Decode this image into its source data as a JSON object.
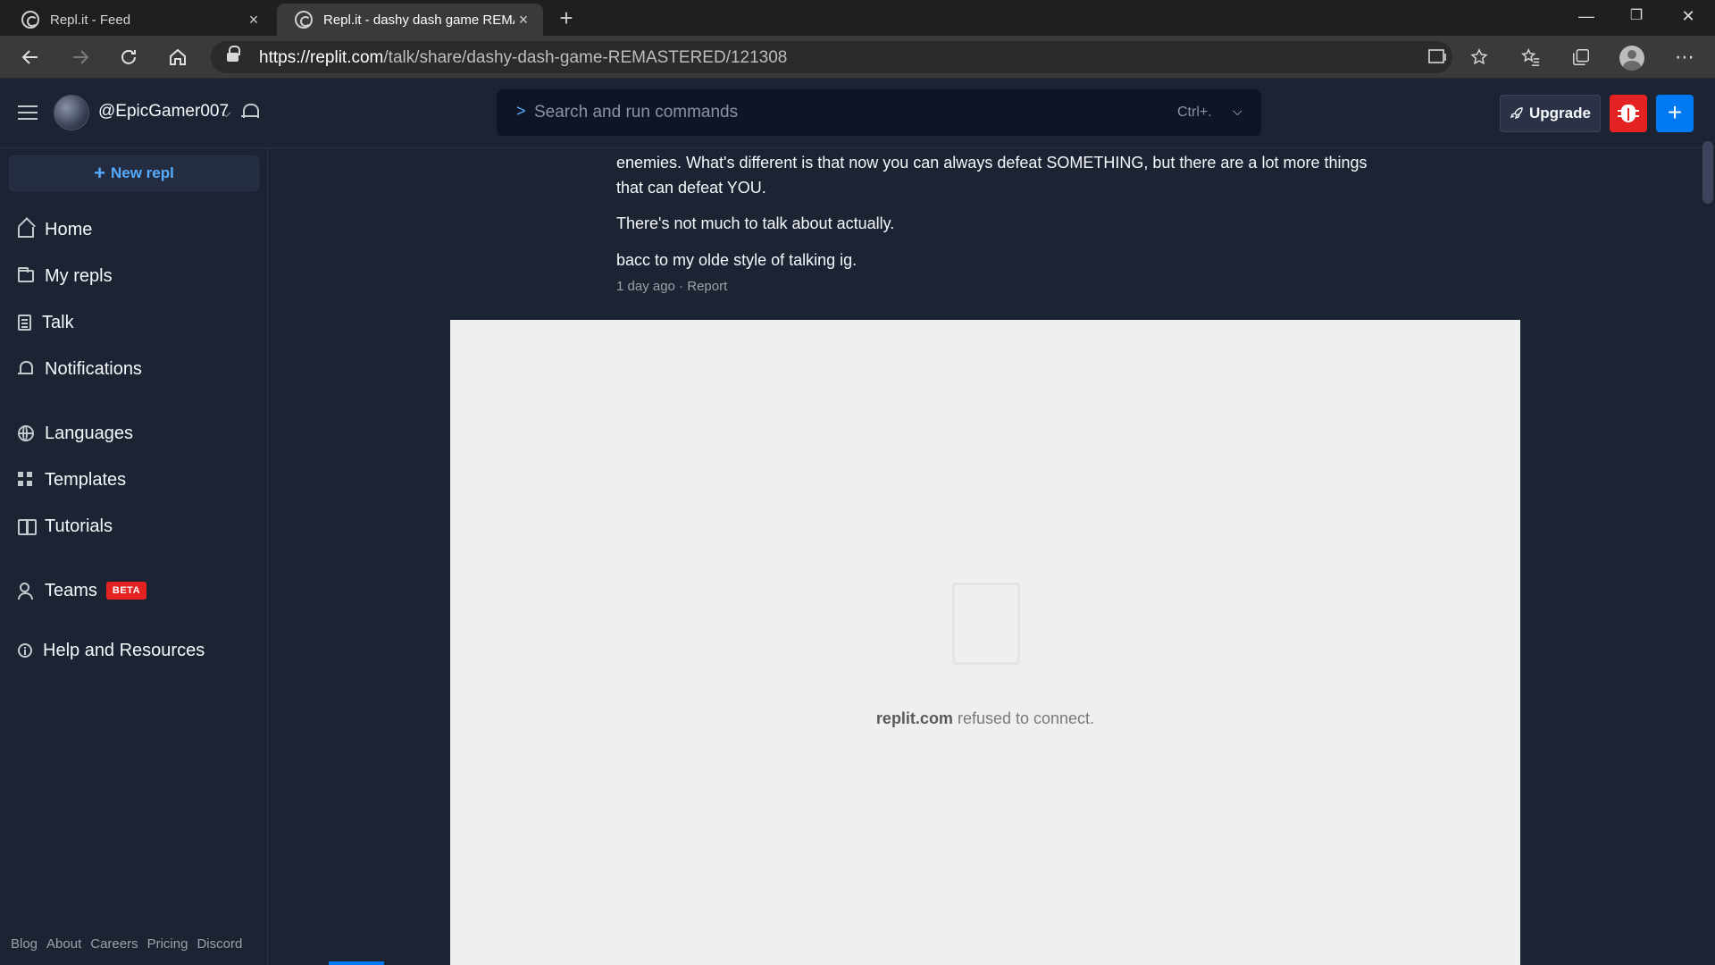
{
  "browser": {
    "tabs": [
      {
        "title": "Repl.it - Feed"
      },
      {
        "title": "Repl.it - dashy dash game REMA"
      }
    ],
    "close_glyph": "×",
    "new_tab_glyph": "+",
    "url_host": "https://replit.com",
    "url_path": "/talk/share/dashy-dash-game-REMASTERED/121308",
    "window_controls": {
      "minimize": "—",
      "maximize": "❐",
      "close": "✕"
    },
    "icons": [
      "back-arrow-icon",
      "forward-arrow-icon",
      "refresh-icon",
      "home-icon",
      "lock-icon",
      "read-aloud-icon",
      "add-favorite-icon",
      "favorites-icon",
      "collections-icon",
      "profile-icon",
      "more-icon"
    ]
  },
  "header": {
    "username": "@EpicGamer007",
    "search_placeholder": "Search and run commands",
    "shortcut": "Ctrl+.",
    "upgrade_label": "Upgrade"
  },
  "sidebar": {
    "new_repl_label": "New repl",
    "items": [
      {
        "label": "Home",
        "icon": "home-icon"
      },
      {
        "label": "My repls",
        "icon": "folder-icon"
      },
      {
        "label": "Talk",
        "icon": "talk-icon"
      },
      {
        "label": "Notifications",
        "icon": "bell-icon"
      },
      {
        "label": "Languages",
        "icon": "globe-icon"
      },
      {
        "label": "Templates",
        "icon": "grid-icon"
      },
      {
        "label": "Tutorials",
        "icon": "book-icon"
      },
      {
        "label": "Teams",
        "icon": "people-icon",
        "badge": "BETA"
      },
      {
        "label": "Help and Resources",
        "icon": "info-icon"
      }
    ],
    "footer_links": [
      "Blog",
      "About",
      "Careers",
      "Pricing",
      "Discord"
    ]
  },
  "post": {
    "paragraphs": [
      "enemies. What's different is that now you can always defeat SOMETHING, but there are a lot more things that can defeat YOU.",
      "There's not much to talk about actually.",
      "bacc to my olde style of talking ig."
    ],
    "timestamp": "1 day ago",
    "separator": " · ",
    "report_label": "Report"
  },
  "embed": {
    "host": "replit.com",
    "message": " refused to connect."
  },
  "colors": {
    "background": "#1c2333",
    "accent_blue": "#0079f2",
    "danger_red": "#e52222",
    "link_blue": "#57abff"
  }
}
